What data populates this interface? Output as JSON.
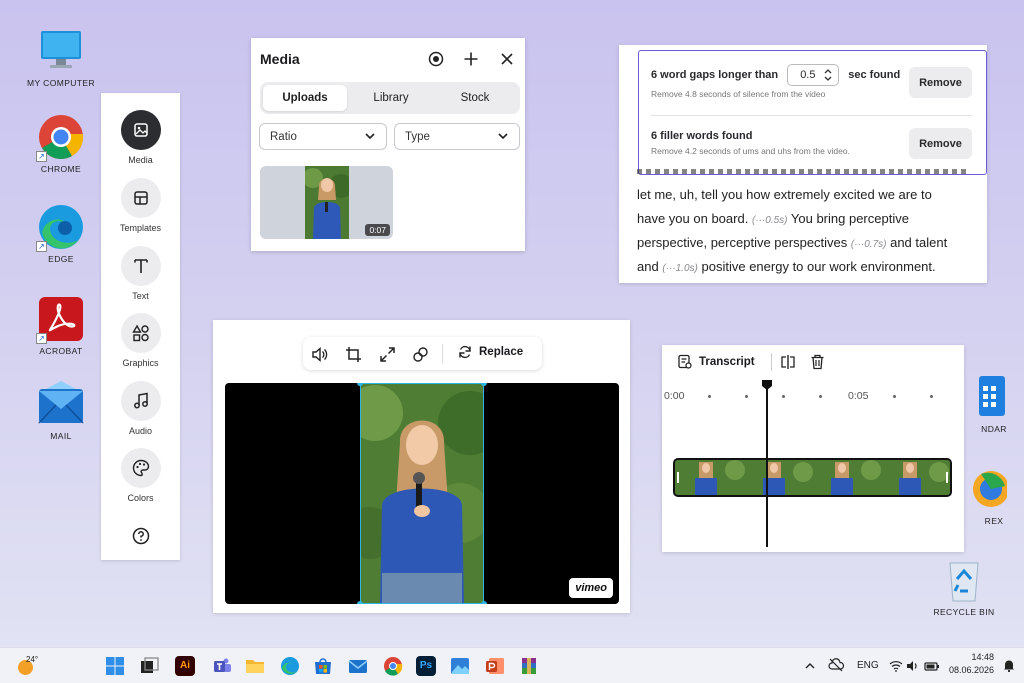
{
  "desktop": {
    "left_icons": [
      {
        "label": "MY COMPUTER",
        "icon": "computer-icon"
      },
      {
        "label": "CHROME",
        "icon": "chrome-icon"
      },
      {
        "label": "EDGE",
        "icon": "edge-icon"
      },
      {
        "label": "ACROBAT",
        "icon": "acrobat-icon"
      },
      {
        "label": "MAIL",
        "icon": "mail-icon"
      }
    ],
    "right_icons": [
      {
        "label": "NDAR",
        "icon": "calendar-icon"
      },
      {
        "label": "REX",
        "icon": "firefox-icon"
      },
      {
        "label": "RECYCLE BIN",
        "icon": "recycle-bin-icon"
      }
    ]
  },
  "rail": {
    "items": [
      {
        "label": "Media",
        "icon": "image-icon",
        "active": true
      },
      {
        "label": "Templates",
        "icon": "templates-icon"
      },
      {
        "label": "Text",
        "icon": "text-icon"
      },
      {
        "label": "Graphics",
        "icon": "graphics-icon"
      },
      {
        "label": "Audio",
        "icon": "music-note-icon"
      },
      {
        "label": "Colors",
        "icon": "palette-icon"
      }
    ],
    "help_icon": "help-icon"
  },
  "media_panel": {
    "title": "Media",
    "tabs": [
      "Uploads",
      "Library",
      "Stock"
    ],
    "selected_tab": "Uploads",
    "ratio_label": "Ratio",
    "type_label": "Type",
    "thumbnail_duration": "0:07"
  },
  "transcript": {
    "gap_title_prefix": "6 word gaps longer than",
    "gap_value": "0.5",
    "gap_title_suffix": "sec found",
    "gap_sub": "Remove 4.8 seconds of silence from the video",
    "filler_title": "6 filler words found",
    "filler_sub": "Remove 4.2 seconds of ums and uhs from the video.",
    "remove_label": "Remove",
    "line1": "let me, uh, tell you how extremely excited we are to",
    "line2a": "have you on board.",
    "line2_pause": "(···0.5s)",
    "line2b": "You bring perceptive",
    "line3a": "perspective, perceptive perspectives",
    "line3_pause": "(···0.7s)",
    "line3b": "and talent",
    "line4a": "and",
    "line4_pause": "(···1.0s)",
    "line4b": "positive energy to our work environment."
  },
  "player": {
    "replace_label": "Replace",
    "watermark": "vimeo"
  },
  "timeline": {
    "transcript_label": "Transcript",
    "time_start": "0:00",
    "time_mid": "0:05"
  },
  "taskbar": {
    "weather": "24°",
    "lang": "ENG",
    "time": "14:48",
    "date": "08.06.2026"
  }
}
